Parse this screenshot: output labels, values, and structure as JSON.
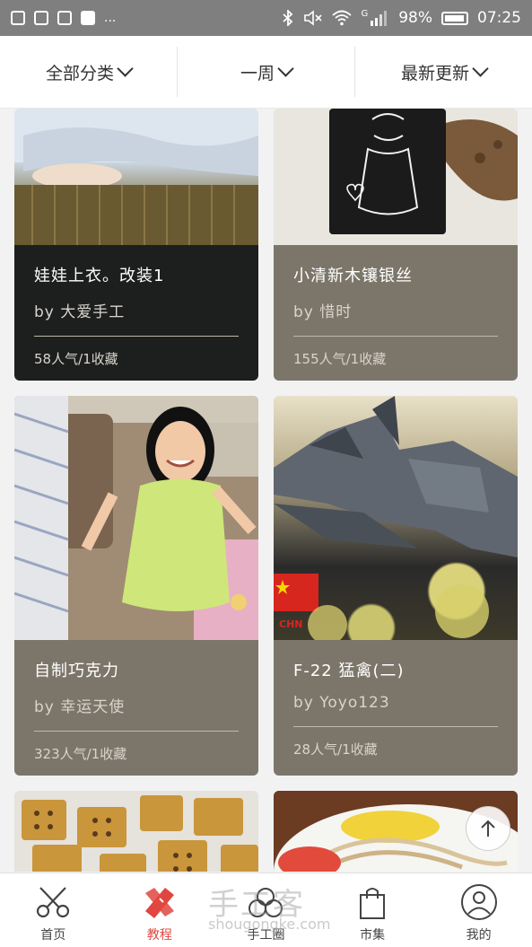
{
  "status_bar": {
    "battery": "98%",
    "time": "07:25",
    "network": "G",
    "more": "..."
  },
  "filters": [
    {
      "label": "全部分类"
    },
    {
      "label": "一周"
    },
    {
      "label": "最新更新"
    }
  ],
  "cards": [
    {
      "title": "娃娃上衣。改装1",
      "author": "by  大爱手工",
      "stats": "58人气/1收藏"
    },
    {
      "title": "小清新木镶银丝",
      "author": "by  惜时",
      "stats": "155人气/1收藏"
    },
    {
      "title": "自制巧克力",
      "author": "by  幸运天使",
      "stats": "323人气/1收藏"
    },
    {
      "title": "F-22 猛禽(二)",
      "author": "by  Yoyo123",
      "stats": "28人气/1收藏"
    }
  ],
  "image_text": {
    "flag_label": "CHN"
  },
  "bottom_nav": [
    {
      "label": "首页",
      "icon": "scissors-icon"
    },
    {
      "label": "教程",
      "icon": "tutorial-icon",
      "active": true
    },
    {
      "label": "手工圈",
      "icon": "circle-community-icon"
    },
    {
      "label": "市集",
      "icon": "shopping-bag-icon"
    },
    {
      "label": "我的",
      "icon": "user-icon"
    }
  ],
  "watermark": {
    "text": "手工客",
    "url": "shougongke.com"
  },
  "colors": {
    "status_bar": "#7f7f7f",
    "card_dark": "#1d1f1f",
    "card_olive": "#7c766a",
    "accent": "#e0463f"
  }
}
